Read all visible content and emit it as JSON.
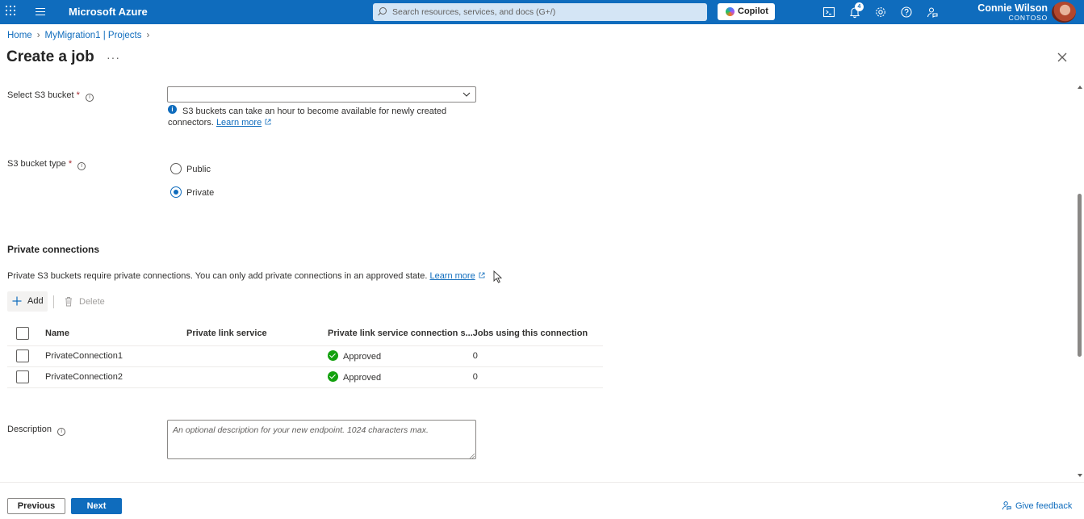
{
  "topbar": {
    "brand": "Microsoft Azure",
    "search_placeholder": "Search resources, services, and docs (G+/)",
    "copilot_label": "Copilot",
    "notification_count": "4",
    "user_name": "Connie Wilson",
    "user_org": "CONTOSO",
    "icons": [
      "app-launcher-icon",
      "menu-icon",
      "search-icon",
      "copilot-icon",
      "cloud-shell-icon",
      "notifications-icon",
      "settings-icon",
      "help-icon",
      "feedback-icon",
      "avatar"
    ]
  },
  "breadcrumb": {
    "items": [
      "Home",
      "MyMigration1 | Projects"
    ]
  },
  "page": {
    "title": "Create a job",
    "more_label": "···"
  },
  "form": {
    "s3_bucket": {
      "label": "Select S3 bucket",
      "required_mark": "*",
      "value": "",
      "note": "S3 buckets can take an hour to become available for newly created",
      "note_cont": "connectors.",
      "learn_more": "Learn more"
    },
    "bucket_type": {
      "label": "S3 bucket type",
      "required_mark": "*",
      "options": [
        "Public",
        "Private"
      ],
      "selected": "Private"
    },
    "private_connections": {
      "heading": "Private connections",
      "description": "Private S3 buckets require private connections. You can only add private connections in an approved state.",
      "learn_more": "Learn more",
      "add_label": "Add",
      "delete_label": "Delete",
      "columns": [
        "Name",
        "Private link service",
        "Private link service connection s...",
        "Jobs using this connection"
      ],
      "rows": [
        {
          "name": "PrivateConnection1",
          "link_service": "",
          "status": "Approved",
          "jobs": "0"
        },
        {
          "name": "PrivateConnection2",
          "link_service": "",
          "status": "Approved",
          "jobs": "0"
        }
      ]
    },
    "description": {
      "label": "Description",
      "placeholder": "An optional description for your new endpoint. 1024 characters max.",
      "value": ""
    }
  },
  "footer": {
    "previous_label": "Previous",
    "next_label": "Next",
    "feedback_label": "Give feedback"
  },
  "colors": {
    "accent": "#0f6cbd",
    "success": "#13a10e",
    "required": "#a4262c"
  }
}
